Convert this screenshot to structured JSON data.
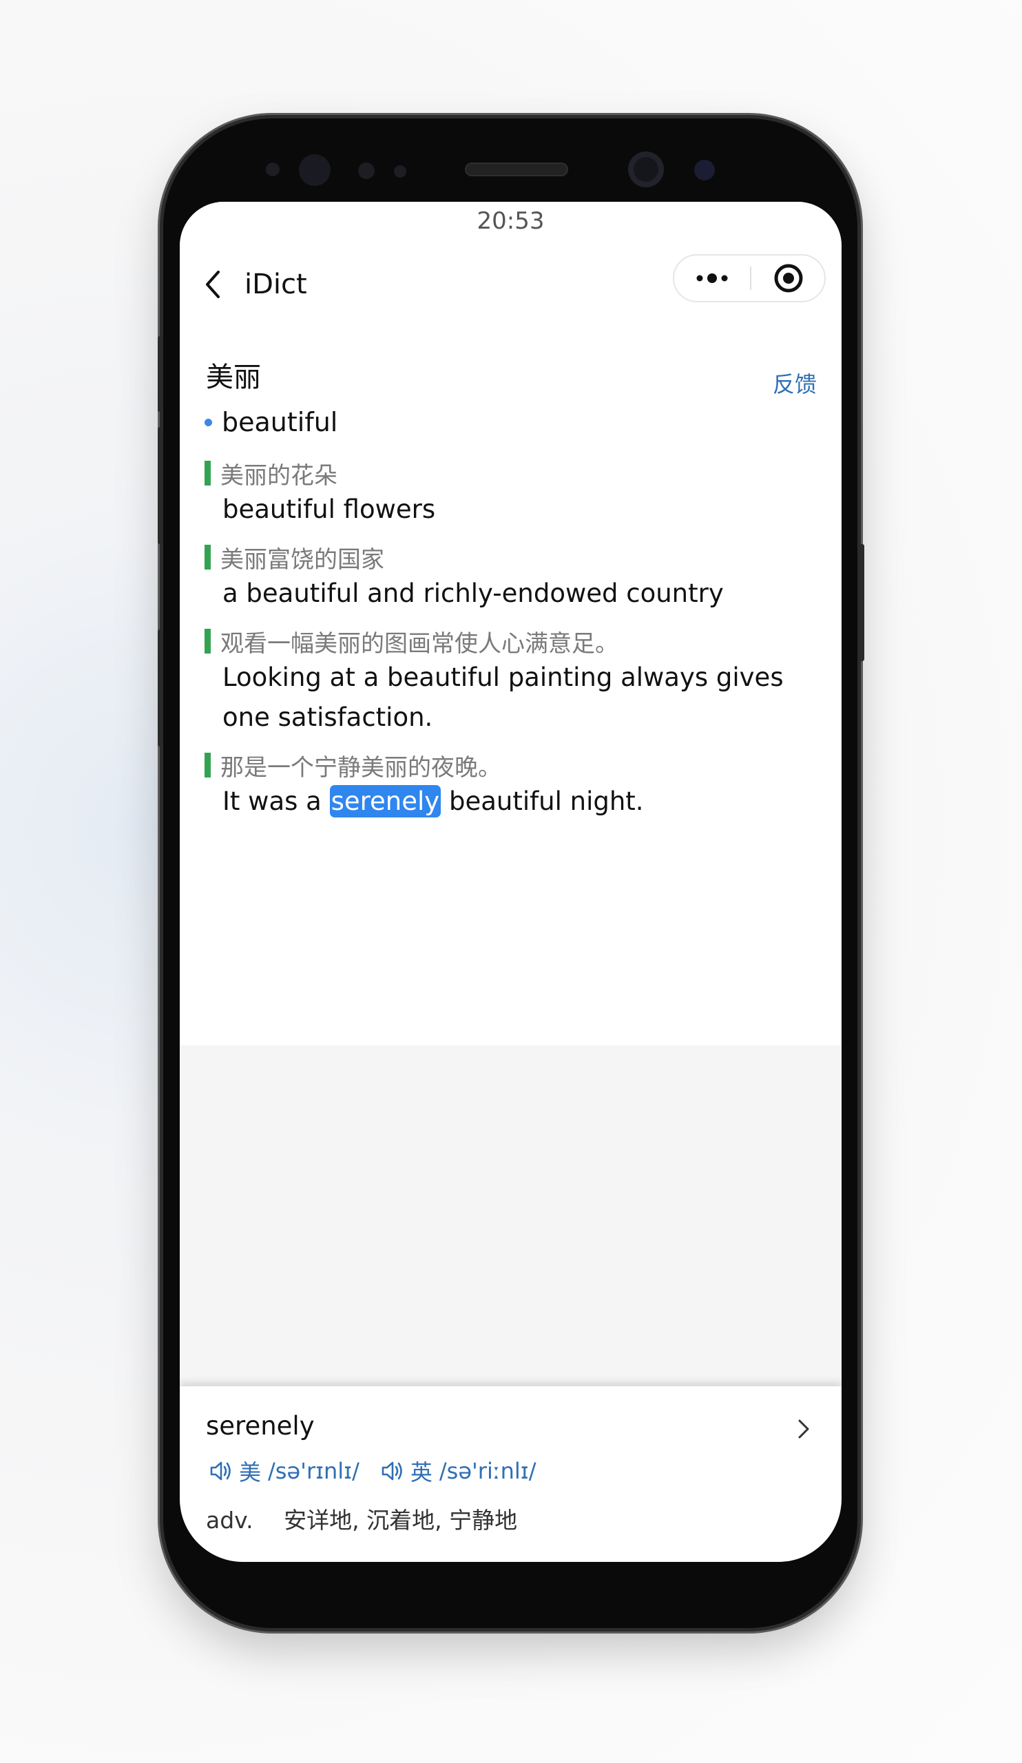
{
  "status_bar": {
    "time": "20:53"
  },
  "nav": {
    "title": "iDict",
    "back_icon": "chevron-left-icon",
    "more_icon": "more-dots-icon",
    "close_icon": "target-circle-icon"
  },
  "entry": {
    "headword": "美丽",
    "feedback_label": "反馈",
    "meaning": "beautiful",
    "examples": [
      {
        "zh": "美丽的花朵",
        "en": "beautiful flowers"
      },
      {
        "zh": "美丽富饶的国家",
        "en": "a beautiful and richly-endowed country"
      },
      {
        "zh": "观看一幅美丽的图画常使人心满意足。",
        "en": "Looking at a beautiful painting always gives one satisfaction."
      },
      {
        "zh": "那是一个宁静美丽的夜晚。",
        "en_before": "It was a",
        "en_highlight": "serenely",
        "en_after": "beautiful night."
      }
    ]
  },
  "word_card": {
    "word": "serenely",
    "us_label": "美",
    "us_phonetic": "/sə'rɪnlɪ/",
    "uk_label": "英",
    "uk_phonetic": "/sə'riːnlɪ/",
    "pos": "adv.",
    "definition": "安详地, 沉着地, 宁静地",
    "speaker_icon": "speaker-icon",
    "arrow_icon": "chevron-right-icon"
  },
  "colors": {
    "accent": "#2f6fb4",
    "highlight": "#2f86ee",
    "example_bar": "#33a351"
  }
}
